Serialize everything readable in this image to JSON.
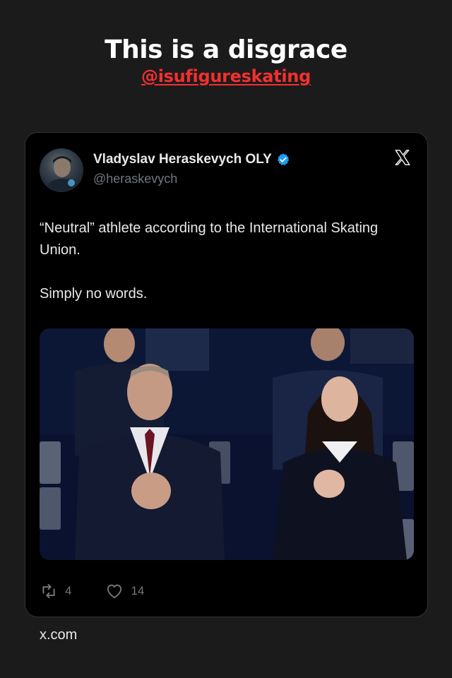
{
  "overlay": {
    "headline": "This is a disgrace",
    "handle": "@isufigureskating",
    "handle_color": "#f2302e"
  },
  "tweet": {
    "author": {
      "name": "Vladyslav Heraskevych OLY",
      "handle": "@heraskevych",
      "verified": true,
      "avatar_icon": "avatar-photo"
    },
    "platform_icon": "x-logo-icon",
    "text_lines": [
      "“Neutral” athlete according to the International Skating Union.",
      "Simply no words."
    ],
    "photo_icon": "event-photo",
    "actions": {
      "retweets": "4",
      "likes": "14"
    }
  },
  "footer": {
    "source": "x.com"
  },
  "colors": {
    "background": "#1c1b1c",
    "card": "#000000",
    "verified_blue": "#1d9bf0",
    "muted": "#71767b"
  }
}
